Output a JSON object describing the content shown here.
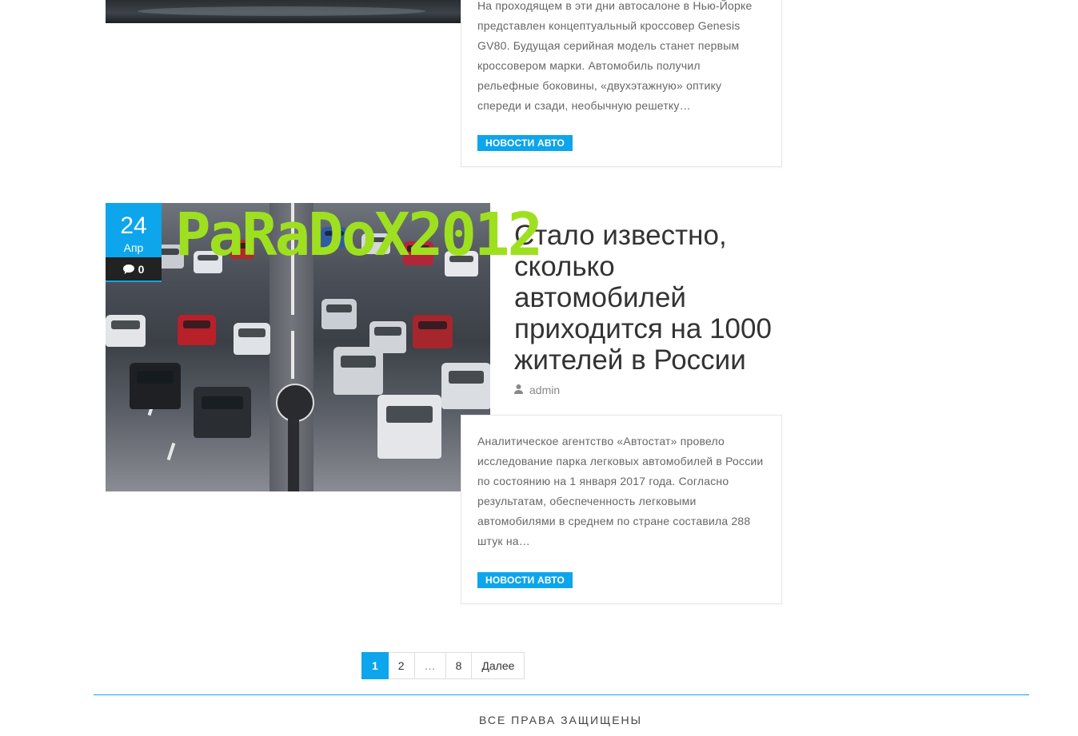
{
  "posts": [
    {
      "excerpt": "На проходящем в эти дни автосалоне в Нью-Йорке представлен концептуальный кроссовер Genesis GV80. Будущая серийная модель станет первым кроссовером марки. Автомобиль получил рельефные боковины, «двухэтажную» оптику спереди и сзади, необычную решетку…",
      "category": "НОВОСТИ АВТО"
    },
    {
      "date_day": "24",
      "date_month": "Апр",
      "comments": "0",
      "title": "Стало известно, сколько автомобилей приходится на 1000 жителей в России",
      "author": "admin",
      "excerpt": " Аналитическое агентство «Автостат» провело исследование парка легковых автомобилей в России по состоянию на 1 января 2017 года. Согласно результатам, обеспеченность легковыми автомобилями в среднем по стране составила 288 штук на…",
      "category": "НОВОСТИ АВТО"
    }
  ],
  "watermark": "PaRaDoX2012",
  "pagination": {
    "pages": [
      "1",
      "2",
      "…",
      "8"
    ],
    "current": "1",
    "next_label": "Далее"
  },
  "footer": {
    "copyright": "ВСЕ ПРАВА ЗАЩИЩЕНЫ"
  },
  "icons": {
    "comment": "comment-icon",
    "author": "user-icon"
  },
  "colors": {
    "accent": "#0da5ec",
    "watermark": "#9ee01f",
    "dark": "#222222"
  }
}
